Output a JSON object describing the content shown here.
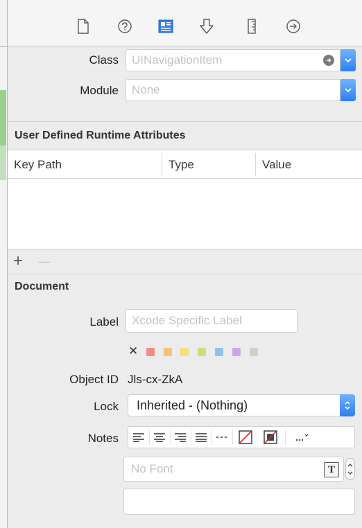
{
  "toolbar": {
    "icons": [
      {
        "name": "file-inspector-icon",
        "selected": false
      },
      {
        "name": "quick-help-icon",
        "selected": false
      },
      {
        "name": "identity-inspector-icon",
        "selected": true
      },
      {
        "name": "attributes-inspector-icon",
        "selected": false
      },
      {
        "name": "size-inspector-icon",
        "selected": false
      },
      {
        "name": "connections-inspector-icon",
        "selected": false
      }
    ],
    "accent": "#2f7ff0"
  },
  "custom_class": {
    "class_label": "Class",
    "class_placeholder": "UINavigationItem",
    "module_label": "Module",
    "module_placeholder": "None"
  },
  "runtime_attributes": {
    "title": "User Defined Runtime Attributes",
    "columns": [
      "Key Path",
      "Type",
      "Value"
    ],
    "rows": [],
    "add_symbol": "+",
    "remove_symbol": "—"
  },
  "document": {
    "title": "Document",
    "label_label": "Label",
    "label_placeholder": "Xcode Specific Label",
    "clear_symbol": "✕",
    "label_colors": [
      "#f08c8c",
      "#f5c27a",
      "#f2e27a",
      "#c8df7a",
      "#8cc2f0",
      "#c9a7ea",
      "#cfcfcf"
    ],
    "object_id_label": "Object ID",
    "object_id_value": "Jls-cx-ZkA",
    "lock_label": "Lock",
    "lock_value": "Inherited - (Nothing)",
    "notes_label": "Notes",
    "font_placeholder": "No Font"
  }
}
